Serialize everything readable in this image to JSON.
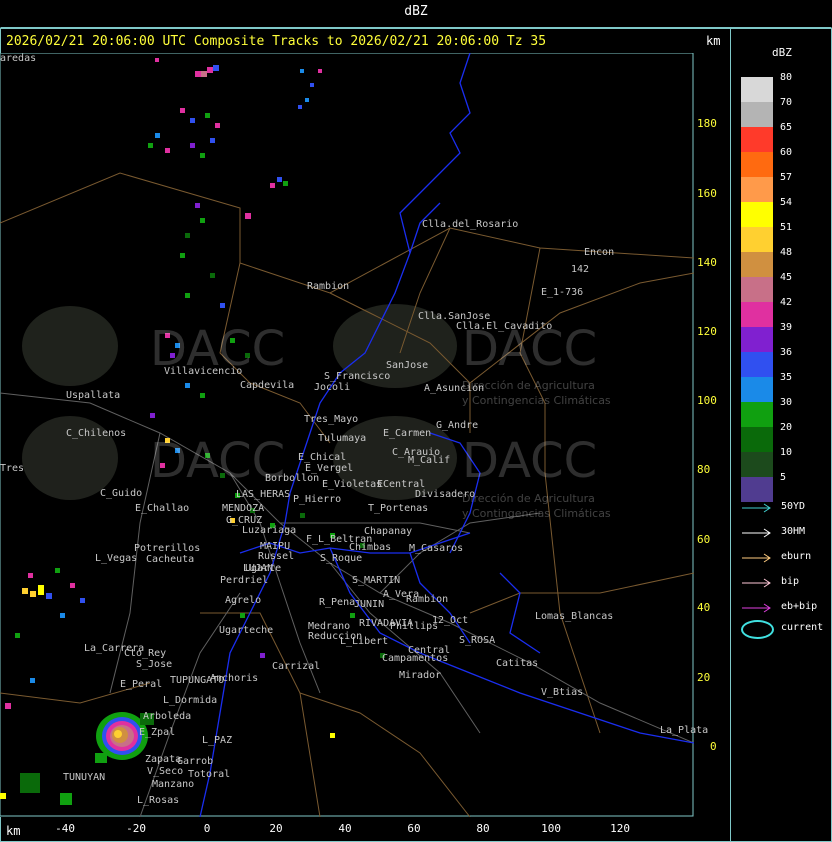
{
  "window_title": "dBZ",
  "header": "2026/02/21 20:06:00 UTC Composite Tracks to 2026/02/21 20:06:00 Tz 35",
  "units": {
    "km_top": "km",
    "km_bottom": "km"
  },
  "y_axis_ticks": [
    "180",
    "160",
    "140",
    "120",
    "100",
    "80",
    "60",
    "40",
    "20",
    "0"
  ],
  "x_axis_ticks": [
    "-40",
    "-20",
    "0",
    "20",
    "40",
    "60",
    "80",
    "100",
    "120"
  ],
  "legend": {
    "title": "dBZ",
    "levels": [
      {
        "label": "80",
        "color": "#d8d8d8"
      },
      {
        "label": "70",
        "color": "#b4b4b4"
      },
      {
        "label": "65",
        "color": "#ff3a2a"
      },
      {
        "label": "60",
        "color": "#ff6a10"
      },
      {
        "label": "57",
        "color": "#ff9a4a"
      },
      {
        "label": "54",
        "color": "#ffff00"
      },
      {
        "label": "51",
        "color": "#ffd030"
      },
      {
        "label": "48",
        "color": "#d09040"
      },
      {
        "label": "45",
        "color": "#c87088"
      },
      {
        "label": "42",
        "color": "#e030a0"
      },
      {
        "label": "39",
        "color": "#8020d0"
      },
      {
        "label": "36",
        "color": "#3050f0"
      },
      {
        "label": "35",
        "color": "#1a8ae8"
      },
      {
        "label": "30",
        "color": "#10a010"
      },
      {
        "label": "20",
        "color": "#0a6a0a"
      },
      {
        "label": "10",
        "color": "#1c4a1c"
      },
      {
        "label": "5",
        "color": "#503c90"
      }
    ],
    "tracks": [
      {
        "label": "50YD",
        "color": "#40d0d0"
      },
      {
        "label": "30HM",
        "color": "#ffffff"
      },
      {
        "label": "eburn",
        "color": "#ffcc80"
      },
      {
        "label": "bip",
        "color": "#ffc8d8"
      },
      {
        "label": "eb+bip",
        "color": "#e040e0"
      }
    ],
    "current_label": "current",
    "current_color": "#40e0e0"
  },
  "watermark": {
    "brand": "DACC",
    "tagline_1": "Dirección de Agricultura",
    "tagline_2": "y Contingencias Climáticas"
  },
  "places": [
    "Clla.del_Rosario",
    "Encon",
    "142",
    "E_1-736",
    "Rambion",
    "Clla.SanJose",
    "Clla.El_Cavadito",
    "Villavicencio",
    "Uspallata",
    "Capdevila",
    "S_Francisco",
    "SanJose",
    "Jocoli",
    "A_Asuncion",
    "Tres_Mayo",
    "Tulumaya",
    "E_Carmen",
    "G_Andre",
    "C_Chilenos",
    "E_Chical",
    "E_Vergel",
    "C_Arauio",
    "M_Calif",
    "Borbollon",
    "E_Violetas",
    "ECentral",
    "Divisadero",
    "C_Guido",
    "LAS_HERAS",
    "P_Hierro",
    "T_Portenas",
    "E_Challao",
    "MENDOZA",
    "G_CRUZ",
    "Luzariaga",
    "Chapanay",
    "F_L_Beltran",
    "Chimbas",
    "M_Casaros",
    "Potrerillos",
    "MAIPU",
    "Russel",
    "S_Roque",
    "L_Vegas",
    "Cacheuta",
    "LUJAN",
    "Ugarte",
    "Medrano",
    "Perdriel",
    "Agrelo",
    "R_Pena",
    "JUNIN",
    "A_Vera",
    "Rambion",
    "S_MARTIN",
    "Lomas_Blancas",
    "Ugarteche",
    "RIVADAVIA",
    "Phillips",
    "12_Oct",
    "S_ROSA",
    "La_Carrera",
    "Cto_Rey",
    "S_Jose",
    "Reduccion",
    "L_Libert",
    "Central",
    "Campamentos",
    "Catitas",
    "Anchoris",
    "Carrizal",
    "Mirador",
    "E_Peral",
    "TUPUNGATO",
    "V_Btias",
    "L_Dormida",
    "Arboleda",
    "E_Zpal",
    "La_Plata",
    "L_PAZ",
    "Zapata",
    "V_Seco",
    "Garrob",
    "Totoral",
    "TUNUYAN",
    "Manzano",
    "L_Rosas",
    "Tres",
    "aredas"
  ]
}
